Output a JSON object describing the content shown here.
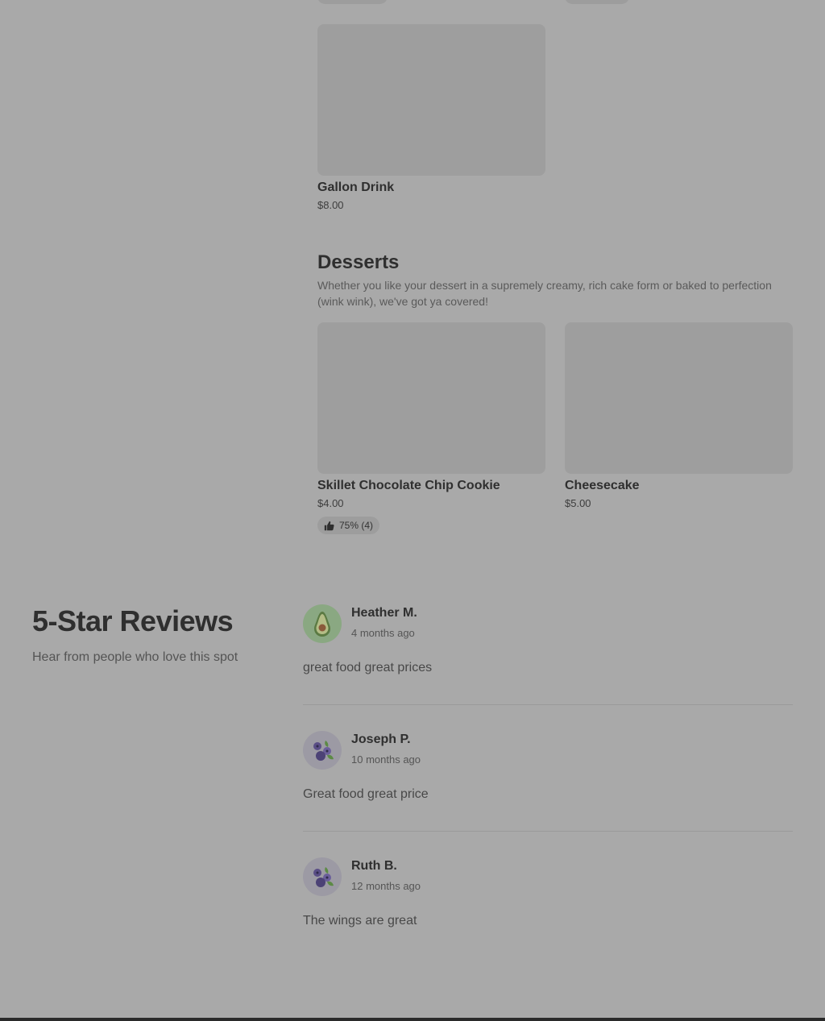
{
  "menu": {
    "drinks": {
      "items": [
        {
          "name": "Gallon Drink",
          "price": "$8.00",
          "image_icon": "food-photo-placeholder"
        }
      ]
    },
    "desserts": {
      "title": "Desserts",
      "description": "Whether you like your dessert in a supremely creamy, rich cake form or baked to perfection (wink wink), we've got ya covered!",
      "items": [
        {
          "name": "Skillet Chocolate Chip Cookie",
          "price": "$4.00",
          "rating": "75% (4)",
          "rating_icon": "thumbs-up-icon",
          "rating_percent": 75,
          "rating_count": 4
        },
        {
          "name": "Cheesecake",
          "price": "$5.00"
        }
      ]
    }
  },
  "reviews": {
    "title": "5-Star Reviews",
    "subtitle": "Hear from people who love this spot",
    "items": [
      {
        "name": "Heather M.",
        "date": "4 months ago",
        "text": "great food great prices",
        "avatar_icon": "avocado-icon"
      },
      {
        "name": "Joseph P.",
        "date": "10 months ago",
        "text": "Great food great price",
        "avatar_icon": "blueberries-icon"
      },
      {
        "name": "Ruth B.",
        "date": "12 months ago",
        "text": "The wings are great",
        "avatar_icon": "blueberries-icon"
      }
    ]
  },
  "colors": {
    "overlay_background": "#a9a9a9",
    "image_placeholder": "#9e9e9e",
    "avocado_avatar_bg": "#8aa882",
    "blueberry_avatar_bg": "#9c9aa4"
  }
}
